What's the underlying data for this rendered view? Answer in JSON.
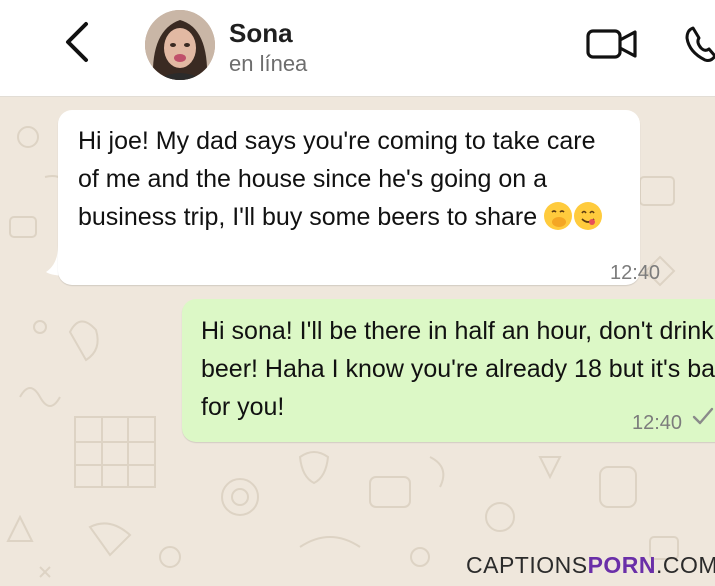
{
  "header": {
    "contact_name": "Sona",
    "status": "en línea",
    "icons": {
      "back": "back-arrow-icon",
      "video": "video-call-icon",
      "call": "phone-call-icon"
    }
  },
  "messages": [
    {
      "direction": "incoming",
      "text": "Hi joe! My dad says you're coming to take care of me and the house since he's going on a business trip, I'll buy some beers to share",
      "emojis": [
        "hand-over-mouth-emoji",
        "face-savoring-food-emoji"
      ],
      "time": "12:40"
    },
    {
      "direction": "outgoing",
      "text": "Hi sona! I'll be there in half an hour, don't drink beer! Haha I know you're already 18 but it's bad for you!",
      "time": "12:40",
      "status_icon": "single-check-icon"
    }
  ],
  "watermark": {
    "part1": "CAPTIONS",
    "part2": "PORN",
    "part3": ".COM"
  },
  "colors": {
    "incoming_bubble": "#ffffff",
    "outgoing_bubble": "#dcf8c6",
    "wallpaper": "#efe7dc",
    "watermark_accent": "#6a2fa8"
  }
}
